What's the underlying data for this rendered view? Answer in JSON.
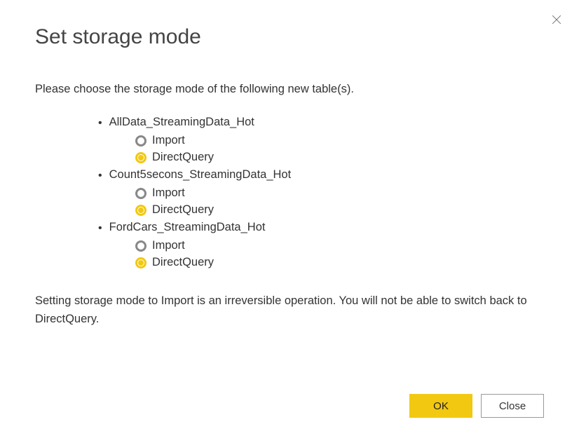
{
  "title": "Set storage mode",
  "instruction": "Please choose the storage mode of the following new table(s).",
  "tables": [
    {
      "name": "AllData_StreamingData_Hot",
      "options": [
        {
          "label": "Import",
          "selected": false
        },
        {
          "label": "DirectQuery",
          "selected": true
        }
      ]
    },
    {
      "name": "Count5secons_StreamingData_Hot",
      "options": [
        {
          "label": "Import",
          "selected": false
        },
        {
          "label": "DirectQuery",
          "selected": true
        }
      ]
    },
    {
      "name": "FordCars_StreamingData_Hot",
      "options": [
        {
          "label": "Import",
          "selected": false
        },
        {
          "label": "DirectQuery",
          "selected": true
        }
      ]
    }
  ],
  "warning": "Setting storage mode to Import is an irreversible operation. You will not be able to switch back to DirectQuery.",
  "buttons": {
    "ok": "OK",
    "close": "Close"
  }
}
